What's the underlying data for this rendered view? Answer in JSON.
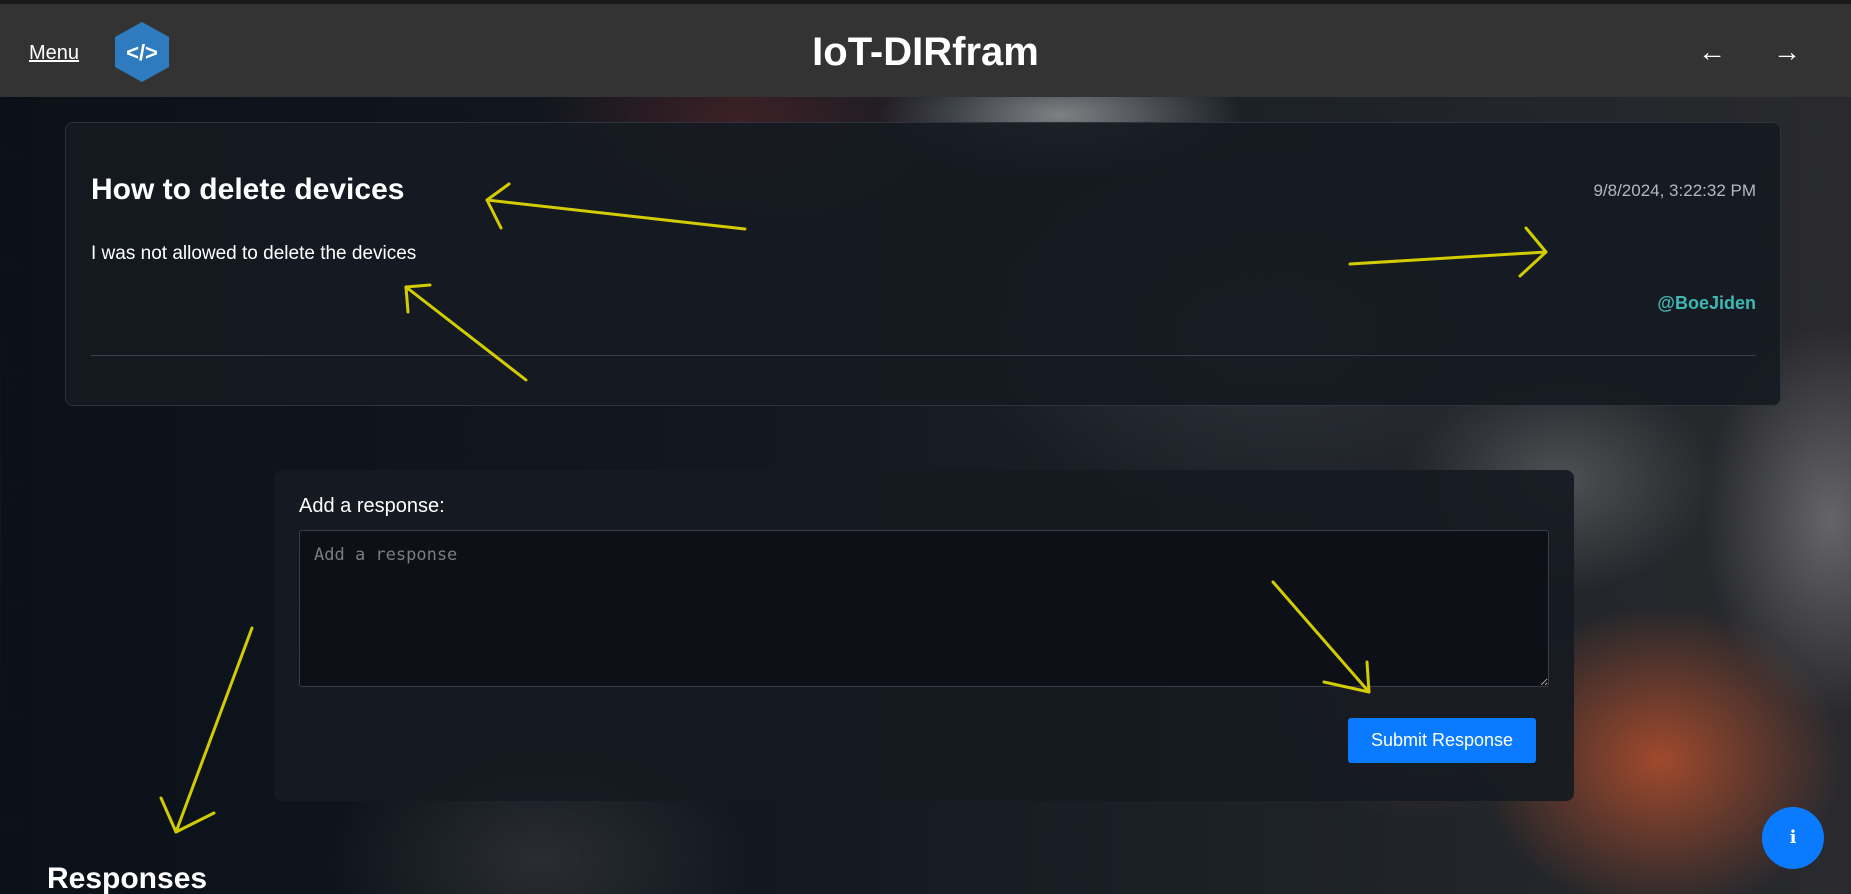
{
  "header": {
    "menu_label": "Menu",
    "logo_icon": "code-brackets-icon",
    "logo_glyph": "</>",
    "title": "IoT-DIRfram",
    "back_glyph": "←",
    "forward_glyph": "→"
  },
  "post": {
    "title": "How to delete devices",
    "timestamp": "9/8/2024, 3:22:32 PM",
    "body": "I was not allowed to delete the devices",
    "author": "@BoeJiden"
  },
  "response_form": {
    "label": "Add a response:",
    "placeholder": "Add a response",
    "value": "",
    "submit_label": "Submit Response"
  },
  "responses": {
    "heading": "Responses"
  },
  "info_button": {
    "glyph": "i",
    "icon": "info-icon"
  },
  "colors": {
    "accent": "#0a7bff",
    "author": "#3fb8b3",
    "annotation_arrows": "#e8e000",
    "header_bg": "#333333",
    "logo_bg": "#2f7bbf"
  }
}
